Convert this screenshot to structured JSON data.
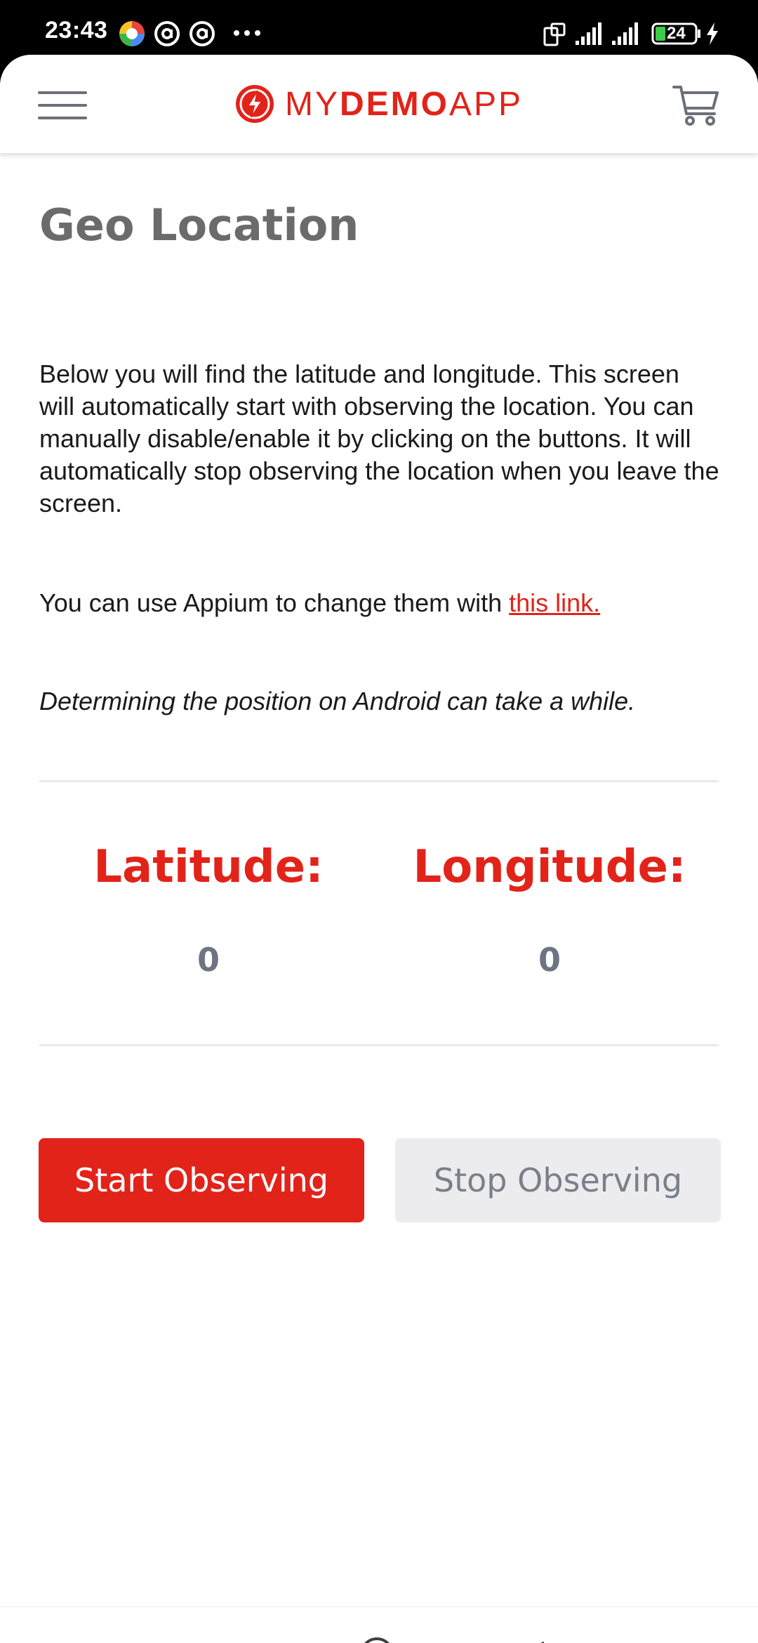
{
  "status_bar": {
    "time": "23:43",
    "battery": "24",
    "icons": [
      "app-notification-icon",
      "at-sign-icon",
      "at-sign-icon",
      "more-dots-icon",
      "rotate-screen-icon",
      "signal-icon",
      "signal-icon",
      "battery-icon",
      "charging-bolt-icon"
    ]
  },
  "header": {
    "brand_prefix": "MY",
    "brand_bold": "DEMO",
    "brand_suffix": "APP",
    "menu_icon": "hamburger-menu-icon",
    "cart_icon": "shopping-cart-icon",
    "logo_icon": "lightning-bolt-logo-icon"
  },
  "page": {
    "title": "Geo Location",
    "description": "Below you will find the latitude and longitude. This screen will automatically start with observing the location. You can manually disable/enable it by clicking on the buttons. It will automatically stop observing the location when you leave the screen.",
    "link_intro": "You can use Appium to change them with ",
    "link_text": "this link.",
    "note": "Determining the position on Android can take a while."
  },
  "coordinates": {
    "latitude_label": "Latitude:",
    "latitude_value": "0",
    "longitude_label": "Longitude:",
    "longitude_value": "0"
  },
  "buttons": {
    "start": "Start Observing",
    "stop": "Stop Observing"
  },
  "nav": {
    "icons": [
      "recent-apps-icon",
      "home-icon",
      "back-icon"
    ]
  },
  "colors": {
    "accent": "#e2231a",
    "title_gray": "#6b6b6b",
    "value_gray": "#6d7482",
    "stop_button_bg": "#ececee"
  }
}
